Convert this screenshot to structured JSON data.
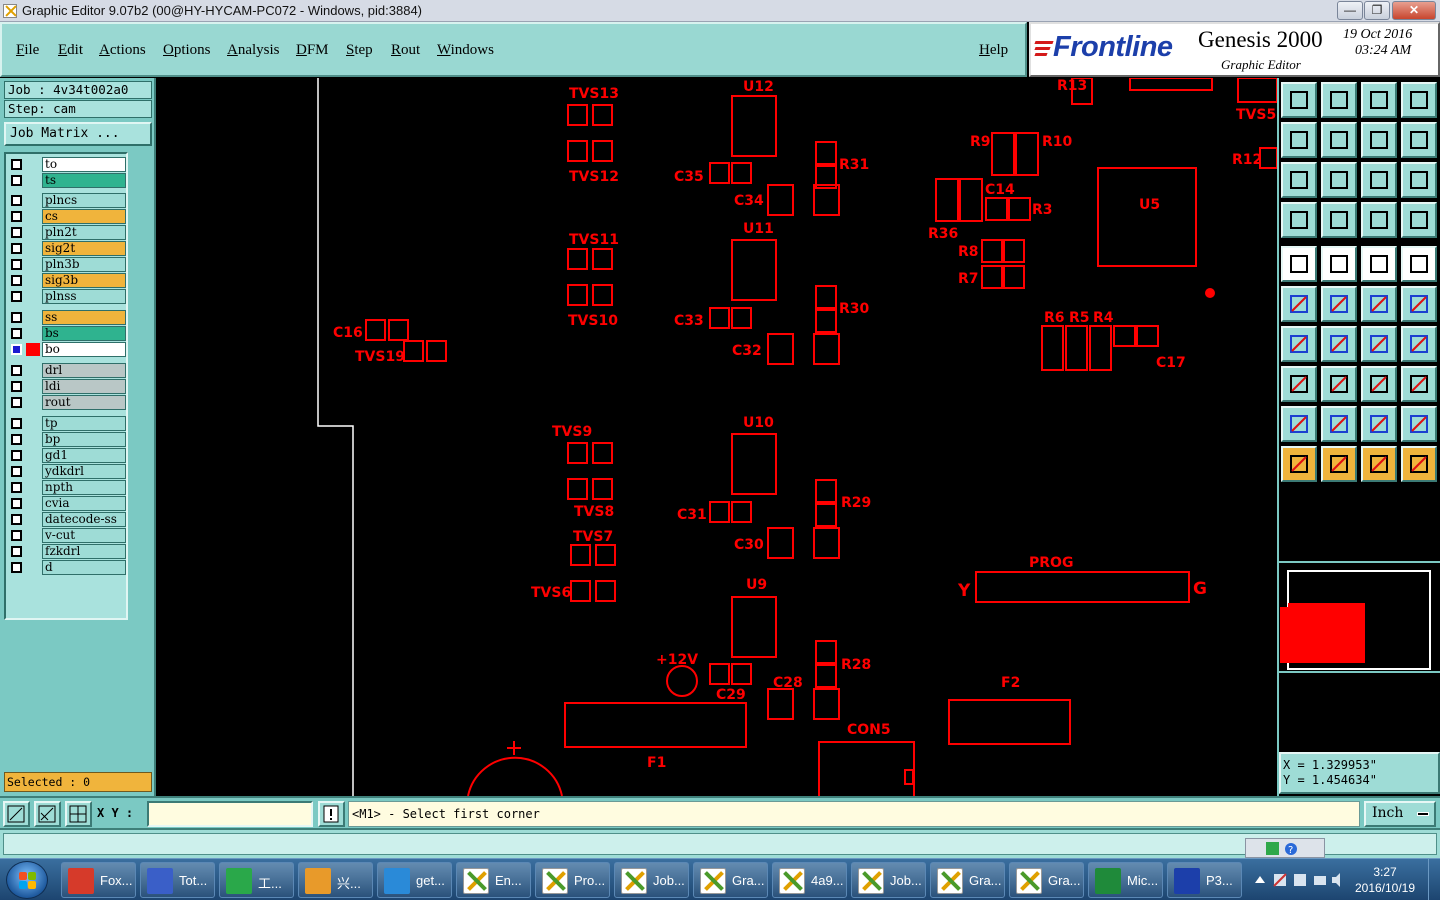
{
  "window": {
    "title": "Graphic Editor 9.07b2 (00@HY-HYCAM-PC072 - Windows, pid:3884)",
    "minimize": "—",
    "maximize": "❐",
    "close": "✕"
  },
  "menu": {
    "items": [
      "File",
      "Edit",
      "Actions",
      "Options",
      "Analysis",
      "DFM",
      "Step",
      "Rout",
      "Windows"
    ],
    "help": "Help"
  },
  "logo": {
    "brand": "Frontline",
    "product": "Genesis 2000",
    "subtitle": "Graphic Editor",
    "date": "19 Oct 2016",
    "time": "03:24 AM"
  },
  "job": {
    "job_line": "Job : 4v34t002a0",
    "step_line": "Step: cam",
    "matrix_button": "Job Matrix ..."
  },
  "layers": [
    {
      "name": "to",
      "style": "white",
      "mark": "✎"
    },
    {
      "name": "ts",
      "style": "green",
      "mark": "✎"
    },
    {
      "name": "plncs",
      "style": "cyan",
      "mark": ""
    },
    {
      "name": "cs",
      "style": "orange",
      "mark": "✎"
    },
    {
      "name": "pln2t",
      "style": "cyan",
      "mark": ""
    },
    {
      "name": "sig2t",
      "style": "orange",
      "mark": "✎"
    },
    {
      "name": "pln3b",
      "style": "cyan",
      "mark": ""
    },
    {
      "name": "sig3b",
      "style": "orange",
      "mark": "✎"
    },
    {
      "name": "plnss",
      "style": "cyan",
      "mark": ""
    },
    {
      "name": "ss",
      "style": "orange",
      "mark": "✎"
    },
    {
      "name": "bs",
      "style": "green",
      "mark": "✎"
    },
    {
      "name": "bo",
      "style": "white",
      "mark": "✎▪",
      "active": true,
      "swatch": "#ff0000"
    },
    {
      "name": "drl",
      "style": "gray",
      "mark": ""
    },
    {
      "name": "ldi",
      "style": "gray",
      "mark": ""
    },
    {
      "name": "rout",
      "style": "gray",
      "mark": ""
    },
    {
      "name": "tp",
      "style": "cyan",
      "mark": ""
    },
    {
      "name": "bp",
      "style": "cyan",
      "mark": ""
    },
    {
      "name": "gd1",
      "style": "cyan",
      "mark": ""
    },
    {
      "name": "ydkdrl",
      "style": "cyan",
      "mark": ""
    },
    {
      "name": "npth",
      "style": "cyan",
      "mark": ""
    },
    {
      "name": "cvia",
      "style": "cyan",
      "mark": ""
    },
    {
      "name": "datecode-ss",
      "style": "cyan",
      "mark": ""
    },
    {
      "name": "v-cut",
      "style": "cyan",
      "mark": ""
    },
    {
      "name": "fzkdrl",
      "style": "cyan",
      "mark": ""
    },
    {
      "name": "d",
      "style": "cyan",
      "mark": ""
    }
  ],
  "selected": "Selected : 0",
  "board_labels": {
    "tvs13": "TVS13",
    "tvs12": "TVS12",
    "tvs11": "TVS11",
    "tvs10": "TVS10",
    "tvs9": "TVS9",
    "tvs8": "TVS8",
    "tvs7": "TVS7",
    "tvs6": "TVS6",
    "tvs19": "TVS19",
    "tvs5": "TVS5",
    "u12": "U12",
    "u11": "U11",
    "u10": "U10",
    "u9": "U9",
    "u5": "U5",
    "c35": "C35",
    "c34": "C34",
    "c33": "C33",
    "c32": "C32",
    "c31": "C31",
    "c30": "C30",
    "c29": "C29",
    "c28": "C28",
    "c16": "C16",
    "c14": "C14",
    "c17": "C17",
    "r31": "R31",
    "r30": "R30",
    "r29": "R29",
    "r28": "R28",
    "r13": "R13",
    "r12": "R12",
    "r9": "R9",
    "r10": "R10",
    "r3": "R3",
    "r36": "R36",
    "r8": "R8",
    "r7": "R7",
    "r6": "R6",
    "r5": "R5",
    "r4": "R4",
    "prog": "PROG",
    "y": "Y",
    "g": "G",
    "plus12v": "+12V",
    "f1": "F1",
    "f2": "F2",
    "con5": "CON5",
    "plus": "+"
  },
  "coords": {
    "x": "X = 1.329953\"",
    "y": "Y = 1.454634\""
  },
  "command": {
    "xy_label": "X Y :",
    "xy_value": "",
    "message": "<M1> - Select first corner",
    "units": "Inch"
  },
  "taskbar": {
    "items": [
      {
        "label": "Fox...",
        "color": "#d63a2a"
      },
      {
        "label": "Tot...",
        "color": "#3a5fc8"
      },
      {
        "label": "工...",
        "color": "#2aa84a"
      },
      {
        "label": "兴...",
        "color": "#e89a2a"
      },
      {
        "label": "get...",
        "color": "#2a8ad8"
      },
      {
        "label": "En...",
        "color": "x"
      },
      {
        "label": "Pro...",
        "color": "x"
      },
      {
        "label": "Job...",
        "color": "x"
      },
      {
        "label": "Gra...",
        "color": "x"
      },
      {
        "label": "4a9...",
        "color": "x"
      },
      {
        "label": "Job...",
        "color": "x"
      },
      {
        "label": "Gra...",
        "color": "x"
      },
      {
        "label": "Gra...",
        "color": "x"
      },
      {
        "label": "Mic...",
        "color": "#1f8a3a"
      },
      {
        "label": "P3...",
        "color": "#1c3faa"
      }
    ],
    "clock_time": "3:27",
    "clock_date": "2016/10/19"
  }
}
